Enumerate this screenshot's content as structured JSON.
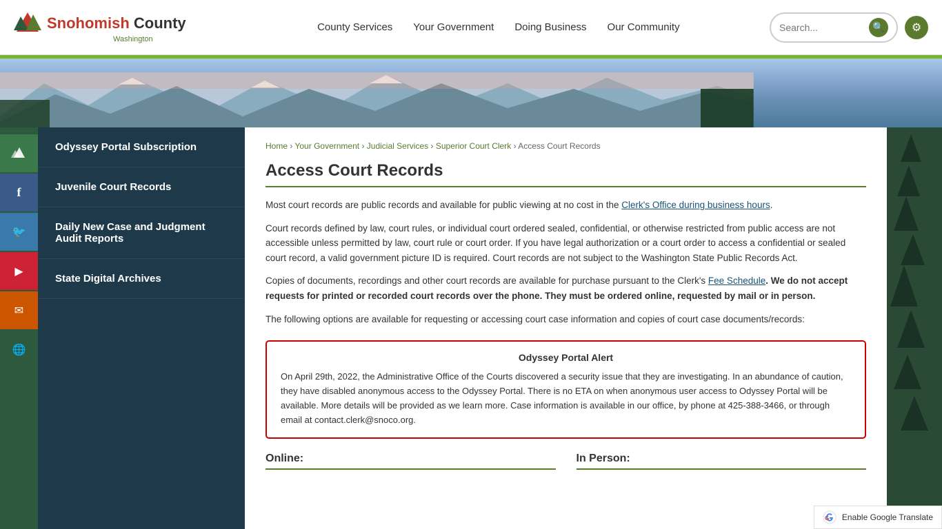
{
  "header": {
    "logo_name": "Snohomish County",
    "logo_sub": "Washington",
    "nav": {
      "items": [
        {
          "label": "County Services"
        },
        {
          "label": "Your Government"
        },
        {
          "label": "Doing Business"
        },
        {
          "label": "Our Community"
        }
      ]
    },
    "search_placeholder": "Search...",
    "green_bar_color": "#7ab32e"
  },
  "social": {
    "items": [
      {
        "icon": "⛰",
        "name": "county-icon"
      },
      {
        "icon": "f",
        "name": "facebook-icon"
      },
      {
        "icon": "🐦",
        "name": "twitter-icon"
      },
      {
        "icon": "▶",
        "name": "youtube-icon"
      },
      {
        "icon": "✉",
        "name": "email-icon"
      },
      {
        "icon": "🌐",
        "name": "translate-icon"
      }
    ]
  },
  "sub_nav": {
    "items": [
      {
        "label": "Odyssey Portal Subscription"
      },
      {
        "label": "Juvenile Court Records"
      },
      {
        "label": "Daily New Case and Judgment Audit Reports"
      },
      {
        "label": "State Digital Archives"
      }
    ]
  },
  "breadcrumb": {
    "items": [
      {
        "label": "Home",
        "href": "#"
      },
      {
        "label": "Your Government",
        "href": "#"
      },
      {
        "label": "Judicial Services",
        "href": "#"
      },
      {
        "label": "Superior Court Clerk",
        "href": "#"
      },
      {
        "label": "Access Court Records",
        "href": "#",
        "current": true
      }
    ],
    "separator": "›"
  },
  "page_title": "Access Court Records",
  "content": {
    "para1": "Most court records are public records and available for public viewing at no cost in the ",
    "para1_link": "Clerk's Office during business hours",
    "para1_end": ".",
    "para2": "Court records defined by law, court rules, or individual court ordered sealed, confidential, or otherwise restricted from public access are not accessible unless permitted by law, court rule or court order.  If you have legal authorization or a court order to access a confidential or sealed court record, a valid government picture ID is required.  Court records are not subject to the Washington State Public Records Act.",
    "para3_start": "Copies of documents, recordings and other court records are available for purchase pursuant to the Clerk's ",
    "para3_link": "Fee Schedule",
    "para3_bold": ".  We do not accept requests for printed or recorded court records over the phone. They must be ordered online, requested by mail or in person.",
    "para4": "The following options are available for requesting or accessing court case information and copies of court case documents/records:",
    "alert_title": "Odyssey Portal Alert",
    "alert_body": "On April 29th, 2022, the Administrative Office of the Courts discovered a security issue that they are investigating. In an abundance of caution, they have disabled anonymous access to the Odyssey Portal. There is no ETA on when anonymous user access to Odyssey Portal will be available. More details will be provided as we learn more. Case information is available in our office, by phone at 425-388-3466, or through email at contact.clerk@snoco.org.",
    "online_label": "Online:",
    "in_person_label": "In Person:"
  },
  "translate_bar": {
    "label": "Enable Google Translate"
  }
}
